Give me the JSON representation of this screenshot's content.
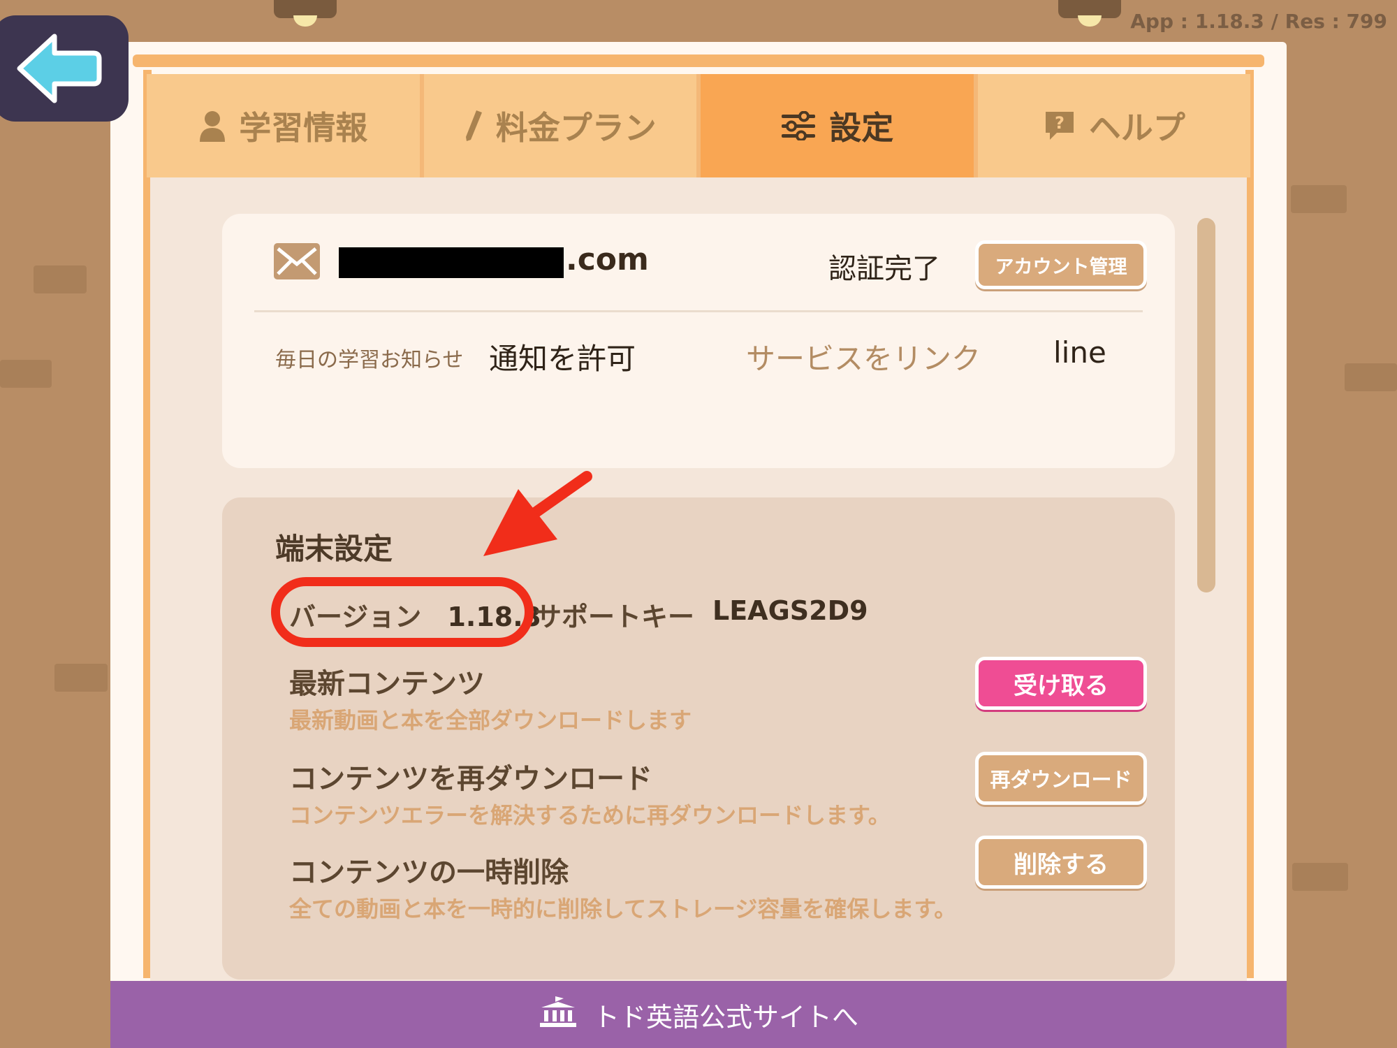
{
  "app_version_label": "App : 1.18.3 / Res : 799",
  "tabs": [
    {
      "label": "学習情報",
      "icon": "person-icon"
    },
    {
      "label": "料金プラン",
      "icon": "pencil-icon"
    },
    {
      "label": "設定",
      "icon": "sliders-icon",
      "active": true
    },
    {
      "label": "ヘルプ",
      "icon": "help-icon"
    }
  ],
  "account": {
    "email_suffix": ".com",
    "status": "認証完了",
    "manage_button": "アカウント管理",
    "notify_label": "毎日の学習お知らせ",
    "notify_value": "通知を許可",
    "link_label": "サービスをリンク",
    "link_value": "line"
  },
  "device": {
    "section_title": "端末設定",
    "version_label": "バージョン",
    "version_value": "1.18.3",
    "support_label": "サポートキー",
    "support_value": "LEAGS2D9",
    "items": [
      {
        "title": "最新コンテンツ",
        "desc": "最新動画と本を全部ダウンロードします",
        "button": "受け取る"
      },
      {
        "title": "コンテンツを再ダウンロード",
        "desc": "コンテンツエラーを解決するために再ダウンロードします。",
        "button": "再ダウンロード"
      },
      {
        "title": "コンテンツの一時削除",
        "desc": "全ての動画と本を一時的に削除してストレージ容量を確保します。",
        "button": "削除する"
      }
    ]
  },
  "footer": {
    "label": "トド英語公式サイトへ",
    "icon": "building-icon"
  },
  "colors": {
    "tab_active": "#f9a653",
    "tab_inactive": "#f9c98c",
    "receive_button": "#ef4d94",
    "footer": "#9a62a8",
    "highlight": "#f12d1a",
    "back_button": "#3d3550"
  }
}
